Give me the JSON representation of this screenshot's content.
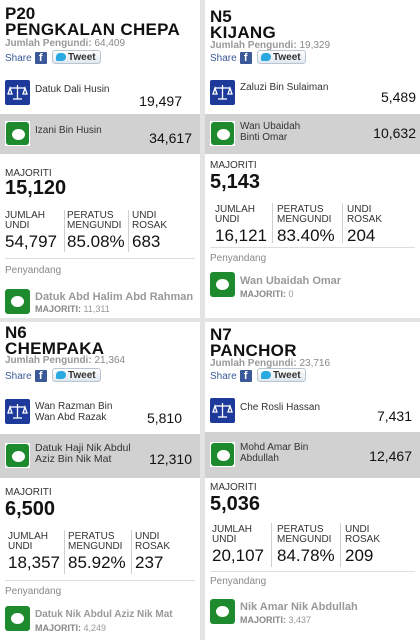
{
  "labels": {
    "voters": "Jumlah Pengundi:",
    "share": "Share",
    "tweet": "Tweet",
    "majority": "MAJORITI",
    "total_votes": "JUMLAH UNDI",
    "turnout": "PERATUS MENGUNDI",
    "spoilt": "UNDI ROSAK",
    "incumbent": "Penyandang",
    "inc_majority": "MAJORITI:"
  },
  "seats": [
    {
      "code": "P20",
      "name": "PENGKALAN CHEPA",
      "voters": "64,409",
      "candidates": [
        {
          "party_icon": "bn-scales-icon",
          "name": "Datuk Dali Husin",
          "votes": "19,497",
          "winner": false
        },
        {
          "party_icon": "pas-moon-icon",
          "name": "Izani Bin Husin",
          "votes": "34,617",
          "winner": true
        }
      ],
      "majority": "15,120",
      "total": "54,797",
      "turnout": "85.08%",
      "spoilt": "683",
      "incumbent": {
        "party_icon": "pas-moon-icon",
        "name": "Datuk Abd Halim Abd Rahman",
        "majority": "11,311"
      }
    },
    {
      "code": "N5",
      "name": "KIJANG",
      "voters": "19,329",
      "candidates": [
        {
          "party_icon": "bn-scales-icon",
          "name": "Zaluzi Bin Sulaiman",
          "votes": "5,489",
          "winner": false
        },
        {
          "party_icon": "pas-moon-icon",
          "name": "Wan Ubaidah Binti Omar",
          "votes": "10,632",
          "winner": true
        }
      ],
      "majority": "5,143",
      "total": "16,121",
      "turnout": "83.40%",
      "spoilt": "204",
      "incumbent": {
        "party_icon": "pas-moon-icon",
        "name": "Wan Ubaidah Omar",
        "majority": "0"
      }
    },
    {
      "code": "N6",
      "name": "CHEMPAKA",
      "voters": "21,364",
      "candidates": [
        {
          "party_icon": "bn-scales-icon",
          "name": "Wan Razman Bin Wan Abd Razak",
          "votes": "5,810",
          "winner": false
        },
        {
          "party_icon": "pas-moon-icon",
          "name": "Datuk Haji Nik Abdul Aziz Bin Nik Mat",
          "votes": "12,310",
          "winner": true
        }
      ],
      "majority": "6,500",
      "total": "18,357",
      "turnout": "85.92%",
      "spoilt": "237",
      "incumbent": {
        "party_icon": "pas-moon-icon",
        "name": "Datuk Nik Abdul Aziz Nik Mat",
        "majority": "4,249"
      }
    },
    {
      "code": "N7",
      "name": "PANCHOR",
      "voters": "23,716",
      "candidates": [
        {
          "party_icon": "bn-scales-icon",
          "name": "Che Rosli Hassan",
          "votes": "7,431",
          "winner": false
        },
        {
          "party_icon": "pas-moon-icon",
          "name": "Mohd Amar Bin Abdullah",
          "votes": "12,467",
          "winner": true
        }
      ],
      "majority": "5,036",
      "total": "20,107",
      "turnout": "84.78%",
      "spoilt": "209",
      "incumbent": {
        "party_icon": "pas-moon-icon",
        "name": "Nik Amar Nik Abdullah",
        "majority": "3,437"
      }
    }
  ]
}
